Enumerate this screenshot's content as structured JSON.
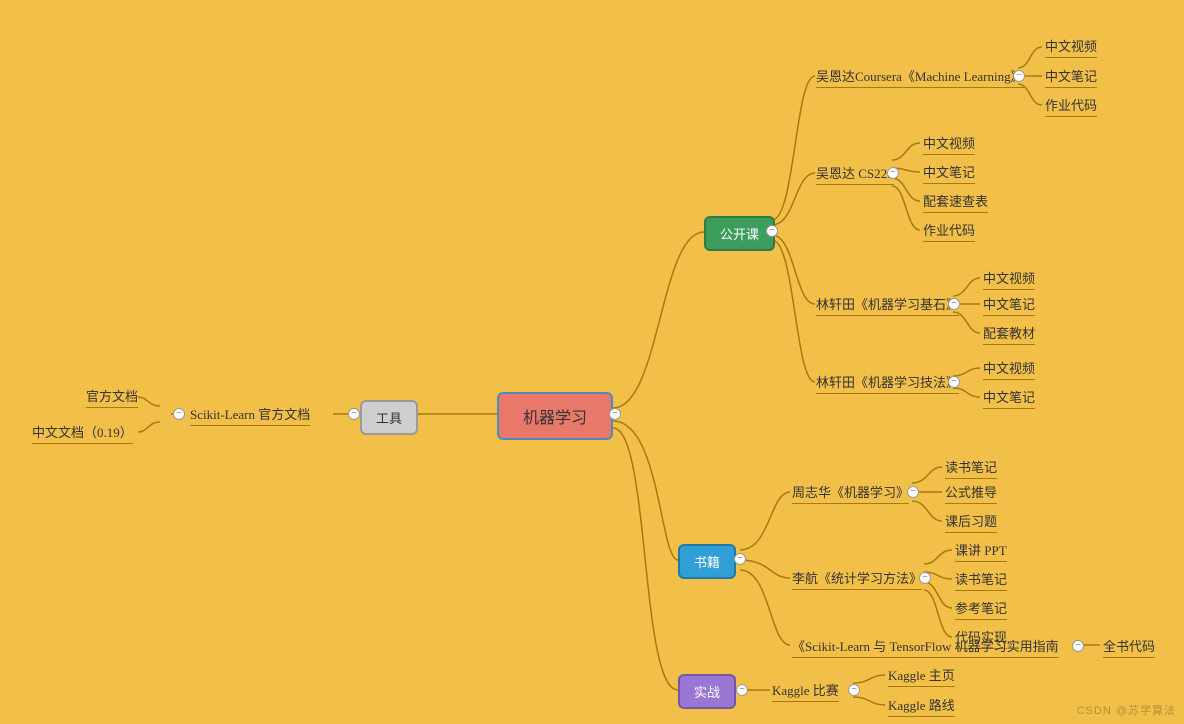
{
  "center": "机器学习",
  "sections": {
    "tools": {
      "label": "工具",
      "sub": "Scikit-Learn 官方文档",
      "leaves": [
        "官方文档",
        "中文文档（0.19）"
      ]
    },
    "courses": {
      "label": "公开课",
      "items": [
        {
          "label": "吴恩达Coursera《Machine Learning》",
          "leaves": [
            "中文视频",
            "中文笔记",
            "作业代码"
          ]
        },
        {
          "label": "吴恩达 CS229",
          "leaves": [
            "中文视频",
            "中文笔记",
            "配套速查表",
            "作业代码"
          ]
        },
        {
          "label": "林轩田《机器学习基石》",
          "leaves": [
            "中文视频",
            "中文笔记",
            "配套教材"
          ]
        },
        {
          "label": "林轩田《机器学习技法》",
          "leaves": [
            "中文视频",
            "中文笔记"
          ]
        }
      ]
    },
    "books": {
      "label": "书籍",
      "items": [
        {
          "label": "周志华《机器学习》",
          "leaves": [
            "读书笔记",
            "公式推导",
            "课后习题"
          ]
        },
        {
          "label": "李航《统计学习方法》",
          "leaves": [
            "课讲 PPT",
            "读书笔记",
            "参考笔记",
            "代码实现"
          ]
        },
        {
          "label": "《Scikit-Learn 与 TensorFlow 机器学习实用指南",
          "leaves": [
            "全书代码"
          ]
        }
      ]
    },
    "practice": {
      "label": "实战",
      "sub": "Kaggle 比赛",
      "leaves": [
        "Kaggle 主页",
        "Kaggle 路线"
      ]
    }
  },
  "handle": "−",
  "watermark": "CSDN @苏学算法"
}
